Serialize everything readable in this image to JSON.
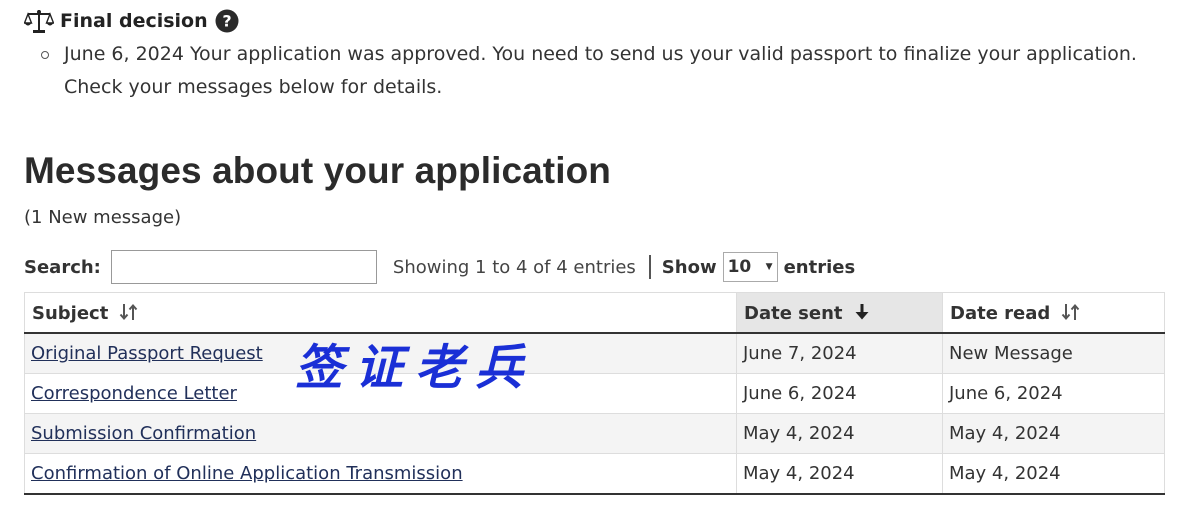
{
  "final_decision": {
    "title": "Final decision",
    "icon": "scale-icon",
    "help_icon": "question-circle-icon",
    "items": [
      {
        "text": "June 6, 2024 Your application was approved. You need to send us your valid passport to finalize your application. Check your messages below for details."
      }
    ]
  },
  "messages": {
    "heading": "Messages about your application",
    "new_count": "(1 New message)",
    "search_label": "Search:",
    "search_value": "",
    "showing_text": "Showing 1 to 4 of 4 entries",
    "show_label": "Show",
    "page_size": "10",
    "entries_label": "entries",
    "columns": [
      {
        "label": "Subject",
        "sort": "unsorted"
      },
      {
        "label": "Date sent",
        "sort": "descending"
      },
      {
        "label": "Date read",
        "sort": "unsorted"
      }
    ],
    "rows": [
      {
        "subject": "Original Passport Request",
        "sent": "June 7, 2024",
        "read": "New Message"
      },
      {
        "subject": "Correspondence Letter",
        "sent": "June 6, 2024",
        "read": "June 6, 2024"
      },
      {
        "subject": "Submission Confirmation",
        "sent": "May 4, 2024",
        "read": "May 4, 2024"
      },
      {
        "subject": "Confirmation of Online Application Transmission",
        "sent": "May 4, 2024",
        "read": "May 4, 2024"
      }
    ]
  },
  "watermark": {
    "text": "签证老兵",
    "color": "#1a2fd6"
  },
  "colors": {
    "link": "#21305a",
    "sorted_header_bg": "#e6e6e6",
    "striped_row_bg": "#f4f4f4"
  }
}
